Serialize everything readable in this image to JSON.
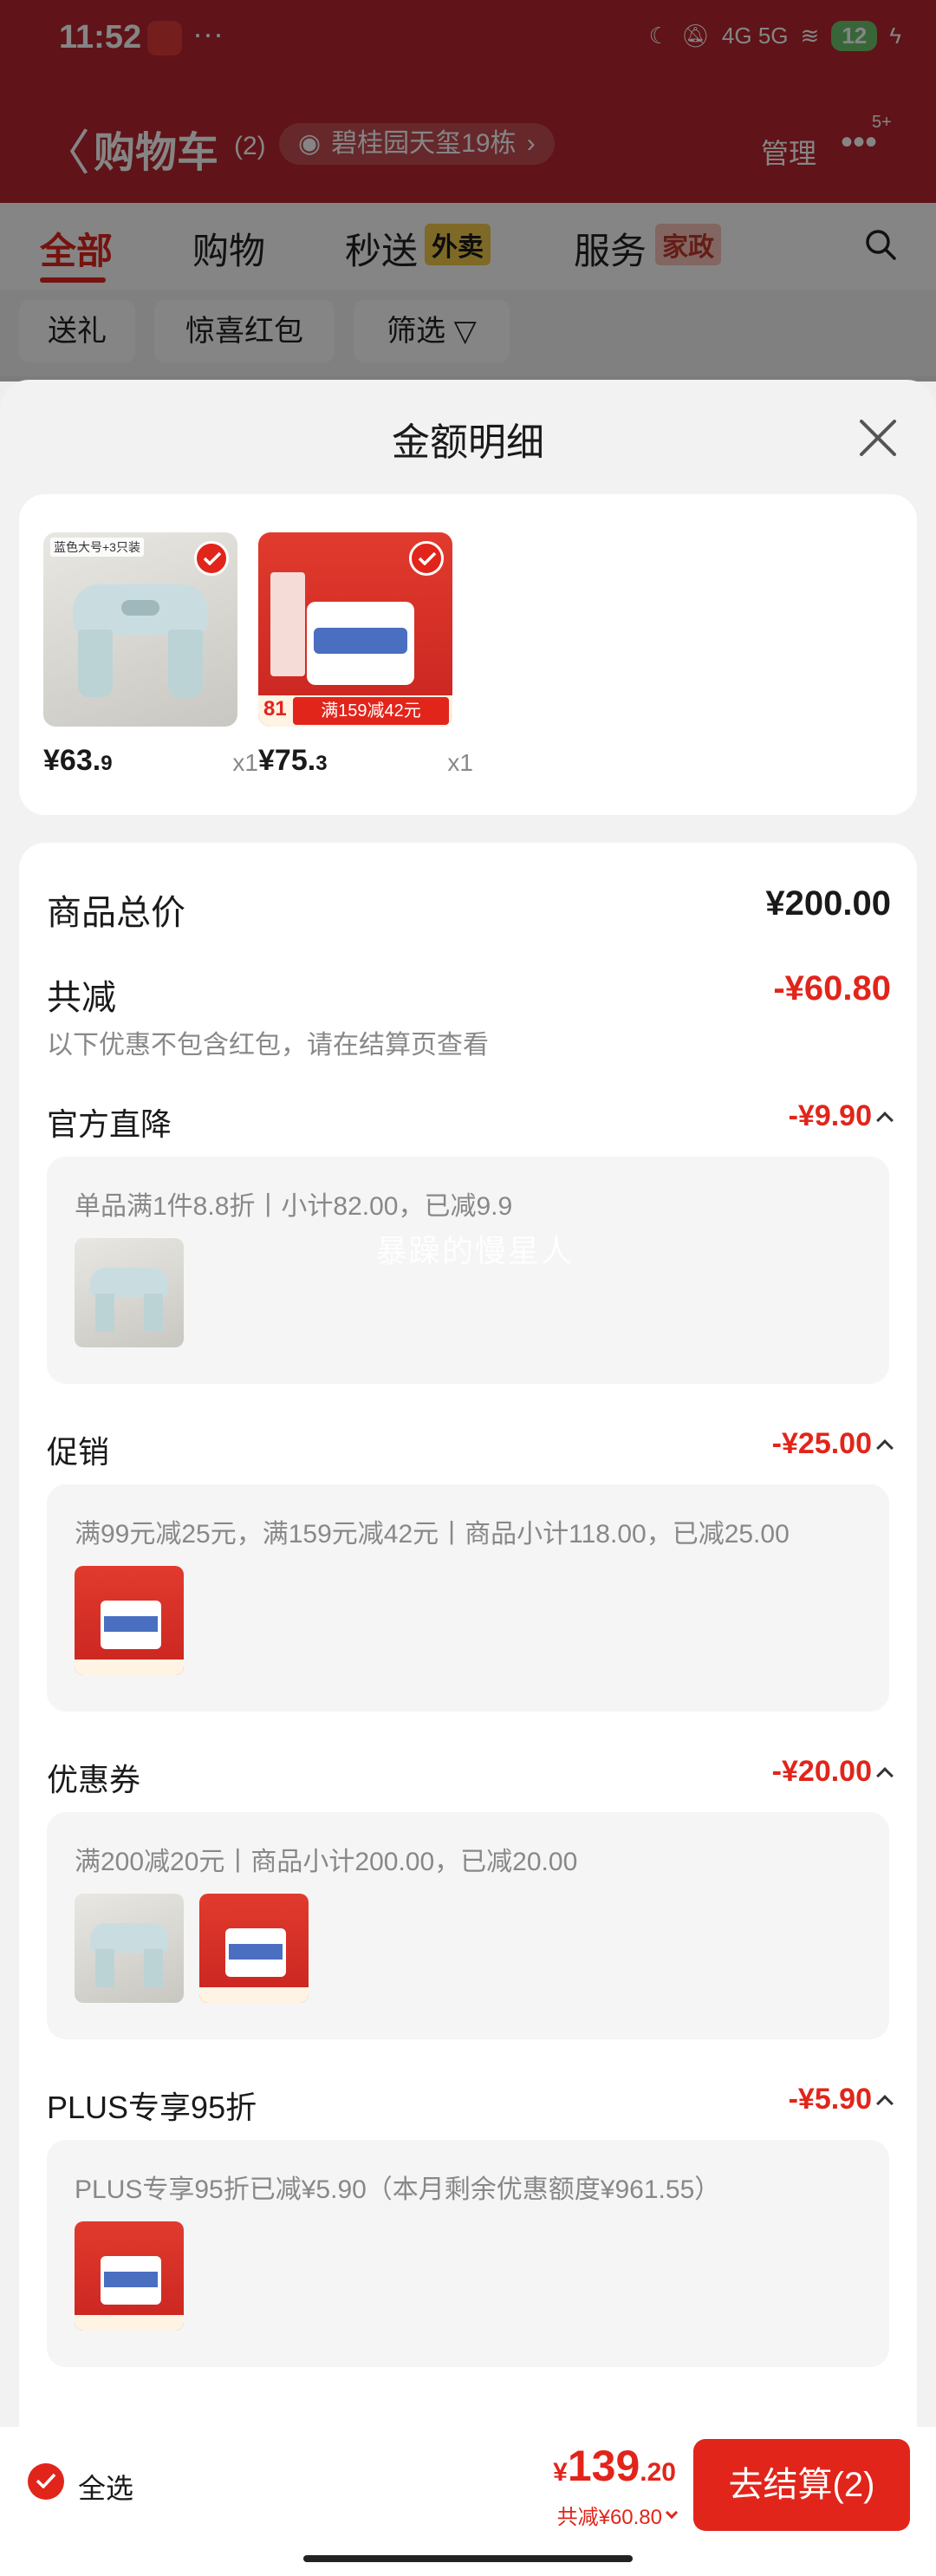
{
  "status_bar": {
    "time": "11:52",
    "dots": "···",
    "network": "4G 5G",
    "battery": "12"
  },
  "header": {
    "back_label": "〈",
    "title": "购物车",
    "count": "(2)",
    "address": "碧桂园天玺19栋",
    "address_chevron": "›",
    "manage": "管理",
    "more": "•••",
    "more_badge": "5+"
  },
  "tabs": [
    {
      "label": "全部",
      "active": true
    },
    {
      "label": "购物",
      "active": false
    },
    {
      "label": "秒送",
      "tag": "外卖",
      "active": false
    },
    {
      "label": "服务",
      "tag": "家政",
      "active": false
    }
  ],
  "filters": [
    "送礼",
    "惊喜红包",
    "筛选"
  ],
  "sheet": {
    "title": "金额明细",
    "products": [
      {
        "thumb": "stool-image",
        "image_text": "蓝色大号+3只装",
        "price_main": "¥63.",
        "price_dec": "9",
        "qty": "x1"
      },
      {
        "thumb": "diaper-image",
        "image_text": "满159减42元",
        "image_num": "81",
        "price_main": "¥75.",
        "price_dec": "3",
        "qty": "x1"
      }
    ],
    "total_label": "商品总价",
    "total_value": "¥200.00",
    "discount_label": "共减",
    "discount_value": "-¥60.80",
    "discount_note": "以下优惠不包含红包，请在结算页查看",
    "sections": [
      {
        "label": "官方直降",
        "value": "-¥9.90",
        "detail": "单品满1件8.8折丨小计82.00，已减9.9",
        "thumbs": [
          "stool"
        ]
      },
      {
        "label": "促销",
        "value": "-¥25.00",
        "detail": "满99元减25元，满159元减42元丨商品小计118.00，已减25.00",
        "thumbs": [
          "diaper"
        ]
      },
      {
        "label": "优惠券",
        "value": "-¥20.00",
        "detail": "满200减20元丨商品小计200.00，已减20.00",
        "thumbs": [
          "stool",
          "diaper"
        ]
      },
      {
        "label": "PLUS专享95折",
        "value": "-¥5.90",
        "detail": "PLUS专享95折已减¥5.90（本月剩余优惠额度¥961.55）",
        "thumbs": [
          "diaper"
        ]
      }
    ],
    "watermark": "暴躁的慢星人"
  },
  "bottom": {
    "select_all": "全选",
    "currency": "¥",
    "total_int": "139",
    "total_dec": ".20",
    "saved": "共减¥60.80",
    "checkout": "去结算(2)"
  },
  "colors": {
    "accent": "#e1251b",
    "header_bg": "#b8262f"
  }
}
